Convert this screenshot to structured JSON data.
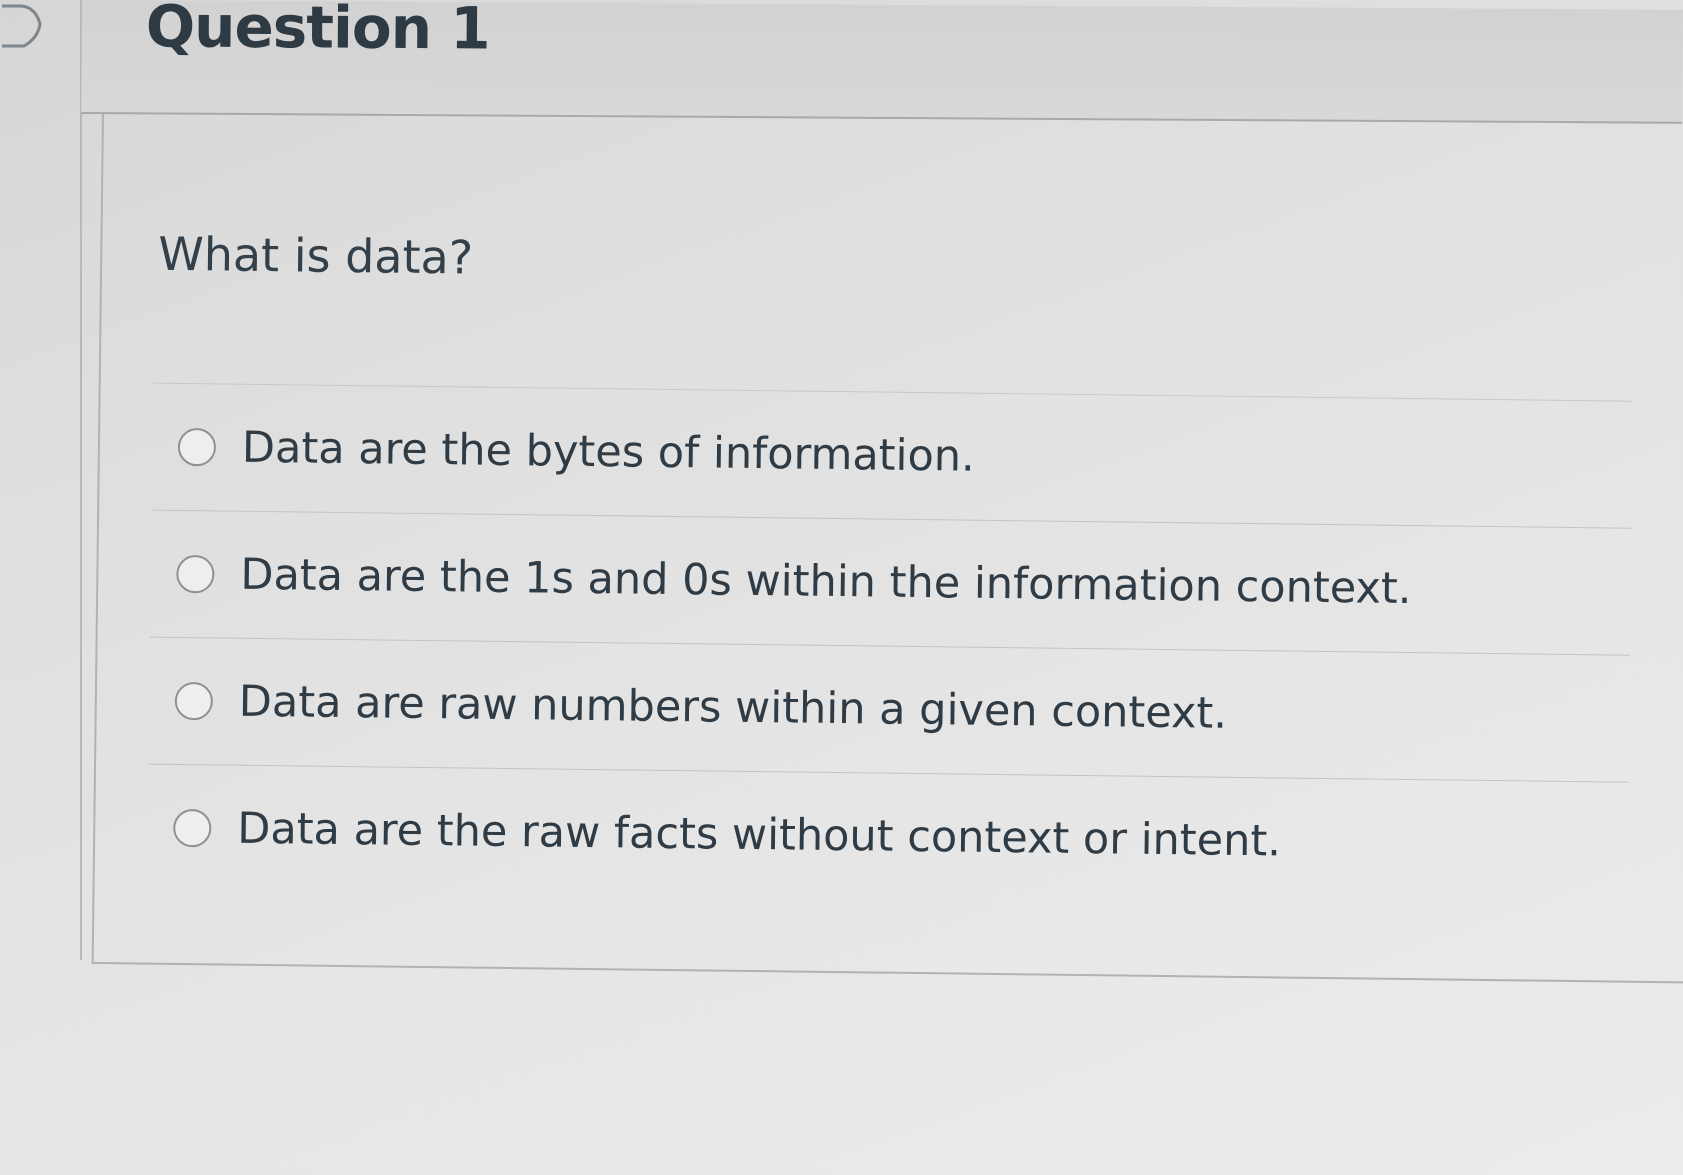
{
  "question": {
    "title": "Question 1",
    "text": "What is data?"
  },
  "answers": [
    {
      "label": "Data are the bytes of information.",
      "selected": false
    },
    {
      "label": "Data are the 1s and 0s within the information context.",
      "selected": false
    },
    {
      "label": "Data are raw numbers within a given context.",
      "selected": false
    },
    {
      "label": "Data are the raw facts without context or intent.",
      "selected": false
    }
  ],
  "icons": {
    "toggle": "chevron-right-icon"
  }
}
